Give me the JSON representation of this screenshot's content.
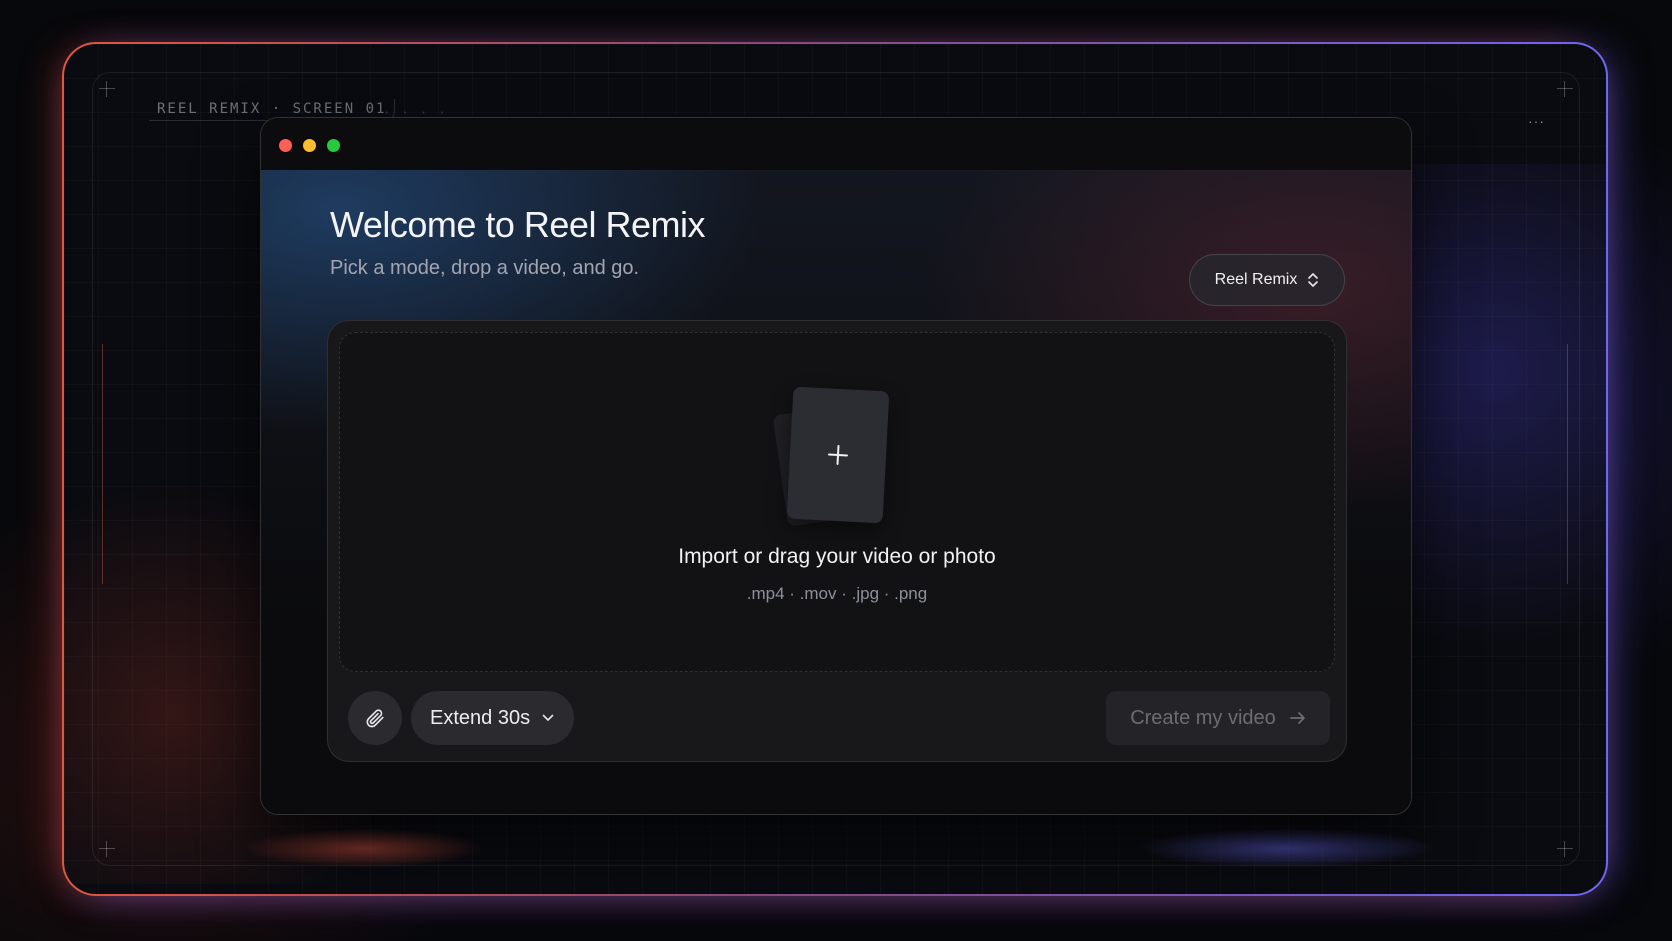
{
  "hud": {
    "label": "REEL REMIX · SCREEN 01",
    "dots": "· · · ·",
    "right_dots": "···"
  },
  "colors": {
    "frame_left": "#e2563d",
    "frame_right": "#6f66f2",
    "traffic_red": "#fe5f57",
    "traffic_yellow": "#febc2e",
    "traffic_green": "#28c840"
  },
  "header": {
    "title": "Welcome to Reel Remix",
    "subtitle": "Pick a mode, drop a video, and go."
  },
  "mode_select": {
    "value": "Reel Remix",
    "icon": "chevron-up-down-icon"
  },
  "dropzone": {
    "icon": "plus-icon",
    "title": "Import or drag your video or photo",
    "formats": ".mp4 · .mov · .jpg · .png"
  },
  "toolbar": {
    "attach_icon": "paperclip-icon",
    "extend_label": "Extend 30s",
    "extend_icon": "chevron-down-icon",
    "create_label": "Create my video",
    "create_icon": "arrow-right-icon"
  }
}
